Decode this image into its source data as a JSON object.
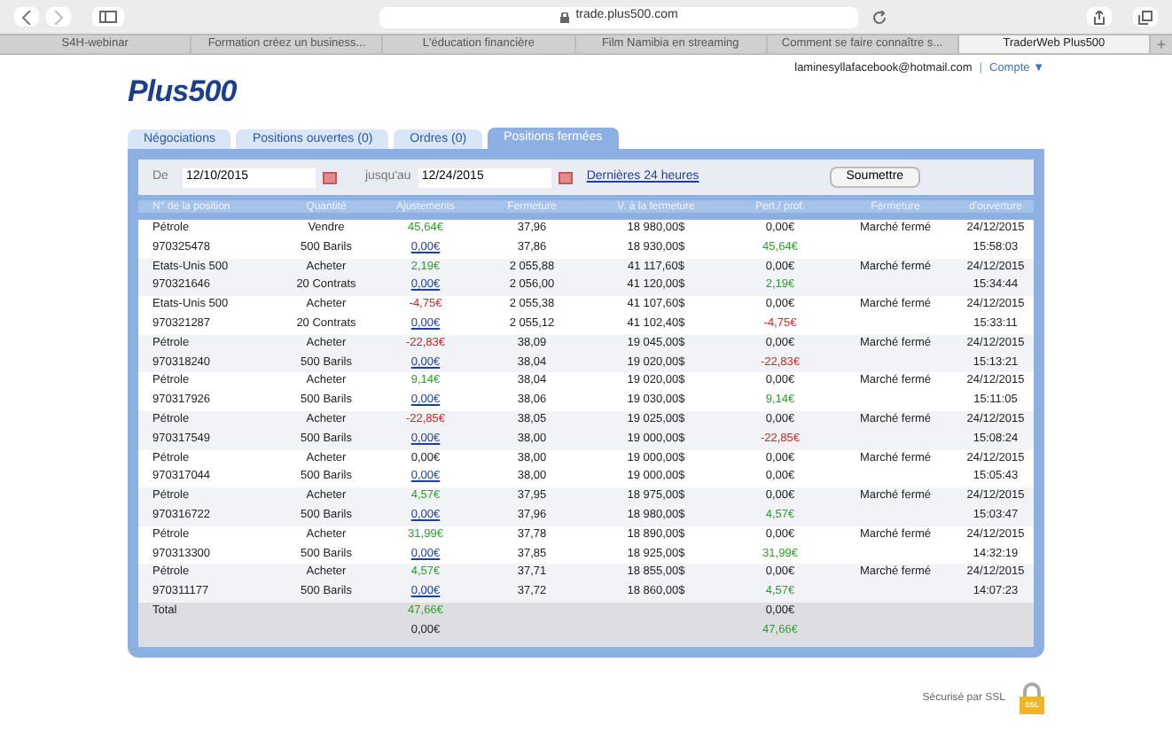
{
  "browser": {
    "url": "trade.plus500.com",
    "tabs": [
      {
        "label": "S4H-webinar",
        "selected": false
      },
      {
        "label": "Formation créez un business...",
        "selected": false
      },
      {
        "label": "L'éducation financière",
        "selected": false
      },
      {
        "label": "Film Namibia en streaming",
        "selected": false
      },
      {
        "label": "Comment se faire connaître s...",
        "selected": false
      },
      {
        "label": "TraderWeb Plus500",
        "selected": true
      }
    ],
    "new_tab": "+"
  },
  "logo": "Plus500",
  "account": {
    "email": "laminesyllafacebook@hotmail.com",
    "separator": "|",
    "menu": "Compte ▼"
  },
  "tabs": [
    {
      "label": "Négociations",
      "selected": false
    },
    {
      "label": "Positions ouvertes (0)",
      "selected": false
    },
    {
      "label": "Ordres (0)",
      "selected": false
    },
    {
      "label": "Positions fermées",
      "selected": true
    }
  ],
  "filter": {
    "from_label": "De",
    "from": "12/10/2015",
    "to_label": "jusqu'au",
    "to": "12/24/2015",
    "link": "Dernières 24 heures",
    "submit": "Soumettre"
  },
  "columns": [
    "N° de la position",
    "Quantité",
    "Ajustements",
    "Fermeture",
    "V. à la fermeture",
    "Pert./ prof.",
    "Fermeture",
    "d'ouverture"
  ],
  "rows": [
    {
      "kind": "gain",
      "name": "Pétrole",
      "id": "970325478",
      "side": "Vendre",
      "qty": "500 Barils",
      "adj": "45,64€",
      "adj2": "0,00€",
      "close1": "37,96",
      "close2": "37,86",
      "val1": "18 980,00$",
      "val2": "18 930,00$",
      "pl1": "0,00€",
      "pl2": "45,64€",
      "status": "Marché fermé",
      "date": "24/12/2015",
      "time": "15:58:03"
    },
    {
      "kind": "gain",
      "name": "Etats-Unis 500",
      "id": "970321646",
      "side": "Acheter",
      "qty": "20 Contrats",
      "adj": "2,19€",
      "adj2": "0,00€",
      "close1": "2 055,88",
      "close2": "2 056,00",
      "val1": "41 117,60$",
      "val2": "41 120,00$",
      "pl1": "0,00€",
      "pl2": "2,19€",
      "status": "Marché fermé",
      "date": "24/12/2015",
      "time": "15:34:44"
    },
    {
      "kind": "loss",
      "name": "Etats-Unis 500",
      "id": "970321287",
      "side": "Acheter",
      "qty": "20 Contrats",
      "adj": "-4,75€",
      "adj2": "0,00€",
      "close1": "2 055,38",
      "close2": "2 055,12",
      "val1": "41 107,60$",
      "val2": "41 102,40$",
      "pl1": "0,00€",
      "pl2": "-4,75€",
      "status": "Marché fermé",
      "date": "24/12/2015",
      "time": "15:33:11"
    },
    {
      "kind": "loss",
      "name": "Pétrole",
      "id": "970318240",
      "side": "Acheter",
      "qty": "500 Barils",
      "adj": "-22,83€",
      "adj2": "0,00€",
      "close1": "38,09",
      "close2": "38,04",
      "val1": "19 045,00$",
      "val2": "19 020,00$",
      "pl1": "0,00€",
      "pl2": "-22,83€",
      "status": "Marché fermé",
      "date": "24/12/2015",
      "time": "15:13:21"
    },
    {
      "kind": "gain",
      "name": "Pétrole",
      "id": "970317926",
      "side": "Acheter",
      "qty": "500 Barils",
      "adj": "9,14€",
      "adj2": "0,00€",
      "close1": "38,04",
      "close2": "38,06",
      "val1": "19 020,00$",
      "val2": "19 030,00$",
      "pl1": "0,00€",
      "pl2": "9,14€",
      "status": "Marché fermé",
      "date": "24/12/2015",
      "time": "15:11:05"
    },
    {
      "kind": "loss",
      "name": "Pétrole",
      "id": "970317549",
      "side": "Acheter",
      "qty": "500 Barils",
      "adj": "-22,85€",
      "adj2": "0,00€",
      "close1": "38,05",
      "close2": "38,00",
      "val1": "19 025,00$",
      "val2": "19 000,00$",
      "pl1": "0,00€",
      "pl2": "-22,85€",
      "status": "Marché fermé",
      "date": "24/12/2015",
      "time": "15:08:24"
    },
    {
      "kind": "zero",
      "name": "Pétrole",
      "id": "970317044",
      "side": "Acheter",
      "qty": "500 Barils",
      "adj": "0,00€",
      "adj2": "0,00€",
      "close1": "38,00",
      "close2": "38,00",
      "val1": "19 000,00$",
      "val2": "19 000,00$",
      "pl1": "0,00€",
      "pl2": "0,00€",
      "status": "Marché fermé",
      "date": "24/12/2015",
      "time": "15:05:43"
    },
    {
      "kind": "gain",
      "name": "Pétrole",
      "id": "970316722",
      "side": "Acheter",
      "qty": "500 Barils",
      "adj": "4,57€",
      "adj2": "0,00€",
      "close1": "37,95",
      "close2": "37,96",
      "val1": "18 975,00$",
      "val2": "18 980,00$",
      "pl1": "0,00€",
      "pl2": "4,57€",
      "status": "Marché fermé",
      "date": "24/12/2015",
      "time": "15:03:47"
    },
    {
      "kind": "gain",
      "name": "Pétrole",
      "id": "970313300",
      "side": "Acheter",
      "qty": "500 Barils",
      "adj": "31,99€",
      "adj2": "0,00€",
      "close1": "37,78",
      "close2": "37,85",
      "val1": "18 890,00$",
      "val2": "18 925,00$",
      "pl1": "0,00€",
      "pl2": "31,99€",
      "status": "Marché fermé",
      "date": "24/12/2015",
      "time": "14:32:19"
    },
    {
      "kind": "gain",
      "name": "Pétrole",
      "id": "970311177",
      "side": "Acheter",
      "qty": "500 Barils",
      "adj": "4,57€",
      "adj2": "0,00€",
      "close1": "37,71",
      "close2": "37,72",
      "val1": "18 855,00$",
      "val2": "18 860,00$",
      "pl1": "0,00€",
      "pl2": "4,57€",
      "status": "Marché fermé",
      "date": "24/12/2015",
      "time": "14:07:23"
    }
  ],
  "total": {
    "label": "Total",
    "adj": "47,66€",
    "adj2": "0,00€",
    "pl1": "0,00€",
    "pl2": "47,66€"
  },
  "ssl": {
    "text": "Sécurisé par SSL",
    "badge": "SSL"
  }
}
